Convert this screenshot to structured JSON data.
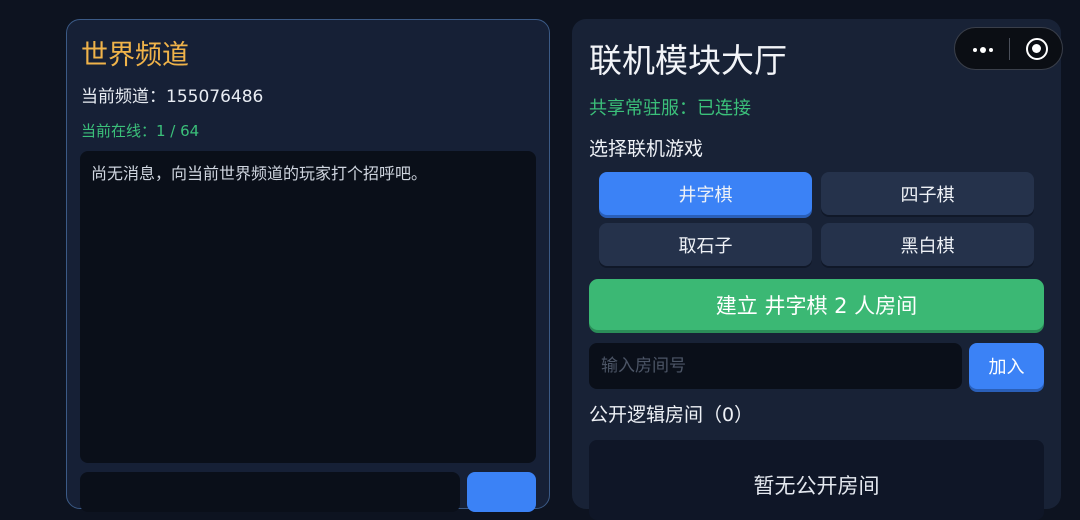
{
  "world": {
    "title": "世界频道",
    "channel": "当前频道：155076486",
    "online": "当前在线：1 / 64",
    "empty_message": "尚无消息，向当前世界频道的玩家打个招呼吧。"
  },
  "lobby": {
    "title": "联机模块大厅",
    "server_status": "共享常驻服：已连接",
    "select_label": "选择联机游戏",
    "games": [
      "井字棋",
      "四子棋",
      "取石子",
      "黑白棋"
    ],
    "selected_game": "井字棋",
    "create_room_label": "建立 井字棋 2 人房间",
    "room_input_placeholder": "输入房间号",
    "join_label": "加入",
    "public_rooms_label": "公开逻辑房间（0）",
    "public_rooms_empty": "暂无公开房间"
  },
  "capsule": {
    "menu_icon": "more-dots-icon",
    "close_icon": "target-circle-icon"
  },
  "colors": {
    "accent_blue": "#3b82f6",
    "accent_green": "#3bb874",
    "title_orange": "#f0b34a",
    "status_green": "#3bc07a"
  }
}
